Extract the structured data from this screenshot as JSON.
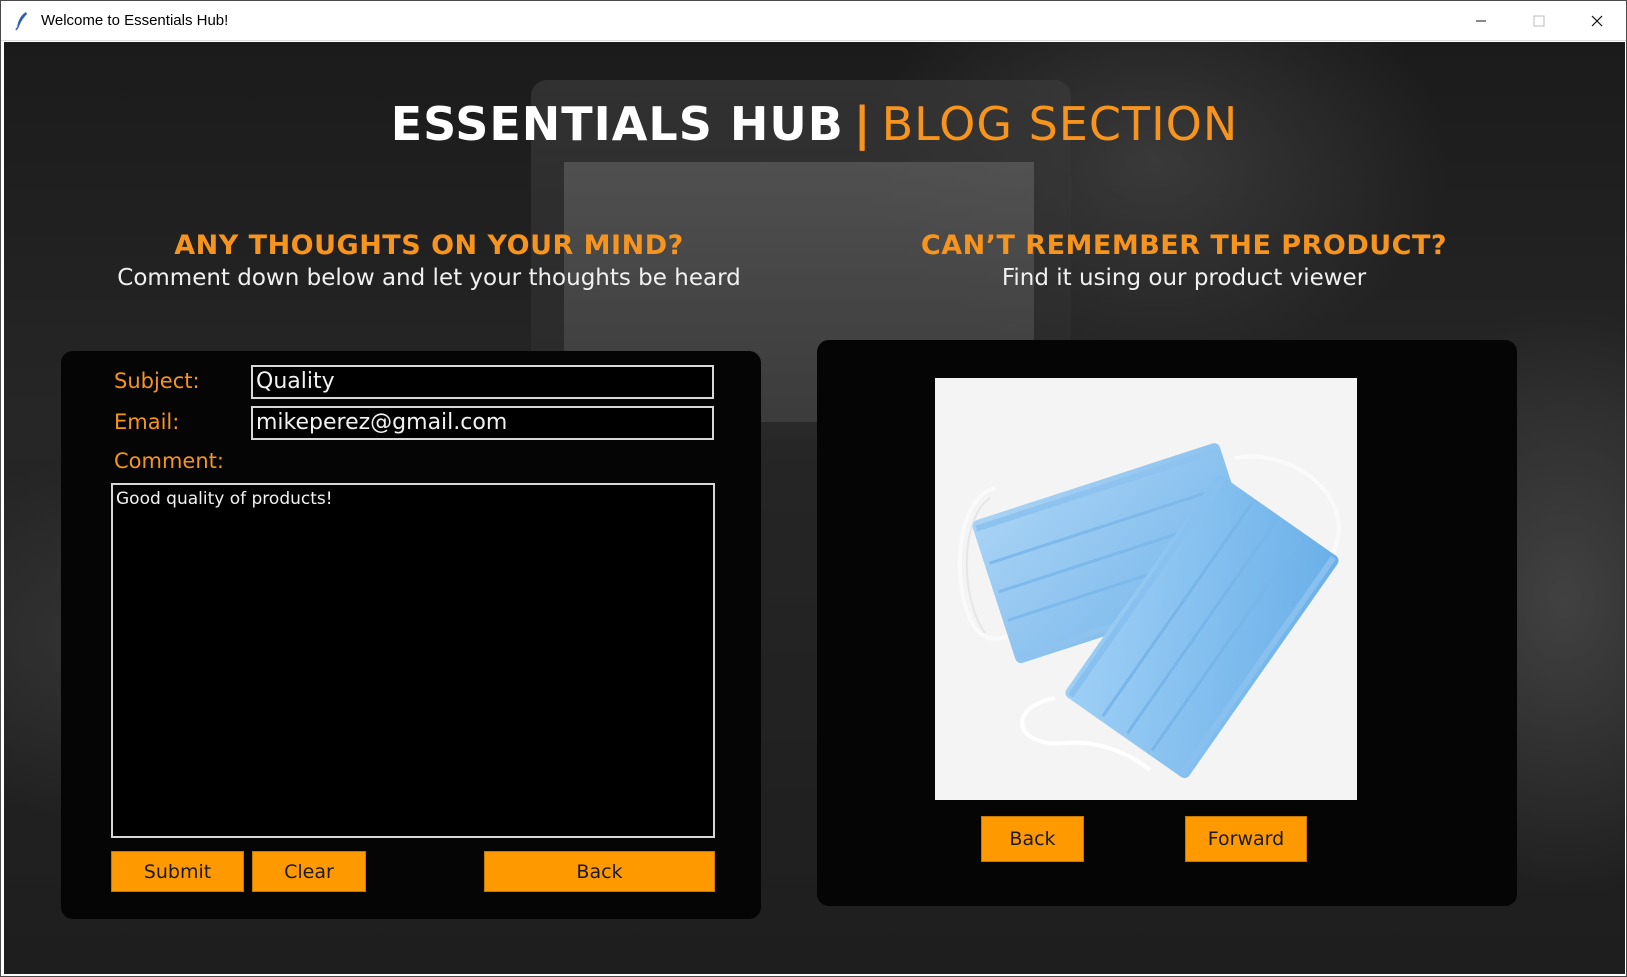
{
  "window": {
    "title": "Welcome to Essentials Hub!",
    "icon": "feather-icon",
    "controls": [
      "minimize-icon",
      "maximize-icon",
      "close-icon"
    ]
  },
  "header": {
    "brand": "ESSENTIALS HUB",
    "separator": "|",
    "section": "BLOG SECTION"
  },
  "left": {
    "title": "ANY THOUGHTS ON YOUR MIND?",
    "subtitle": "Comment down below and let your thoughts be heard"
  },
  "right": {
    "title": "CAN’T REMEMBER THE PRODUCT?",
    "subtitle": "Find it using our product viewer"
  },
  "form": {
    "subject_label": "Subject:",
    "subject_value": "Quality",
    "email_label": "Email:",
    "email_value": "mikeperez@gmail.com",
    "comment_label": "Comment:",
    "comment_value": "Good quality of products!",
    "submit_label": "Submit",
    "clear_label": "Clear",
    "back_label": "Back"
  },
  "viewer": {
    "product_image": "face-mask-product-image",
    "back_label": "Back",
    "forward_label": "Forward"
  },
  "colors": {
    "accent": "#f7941d",
    "button": "#ff9900",
    "panel": "#050505"
  }
}
